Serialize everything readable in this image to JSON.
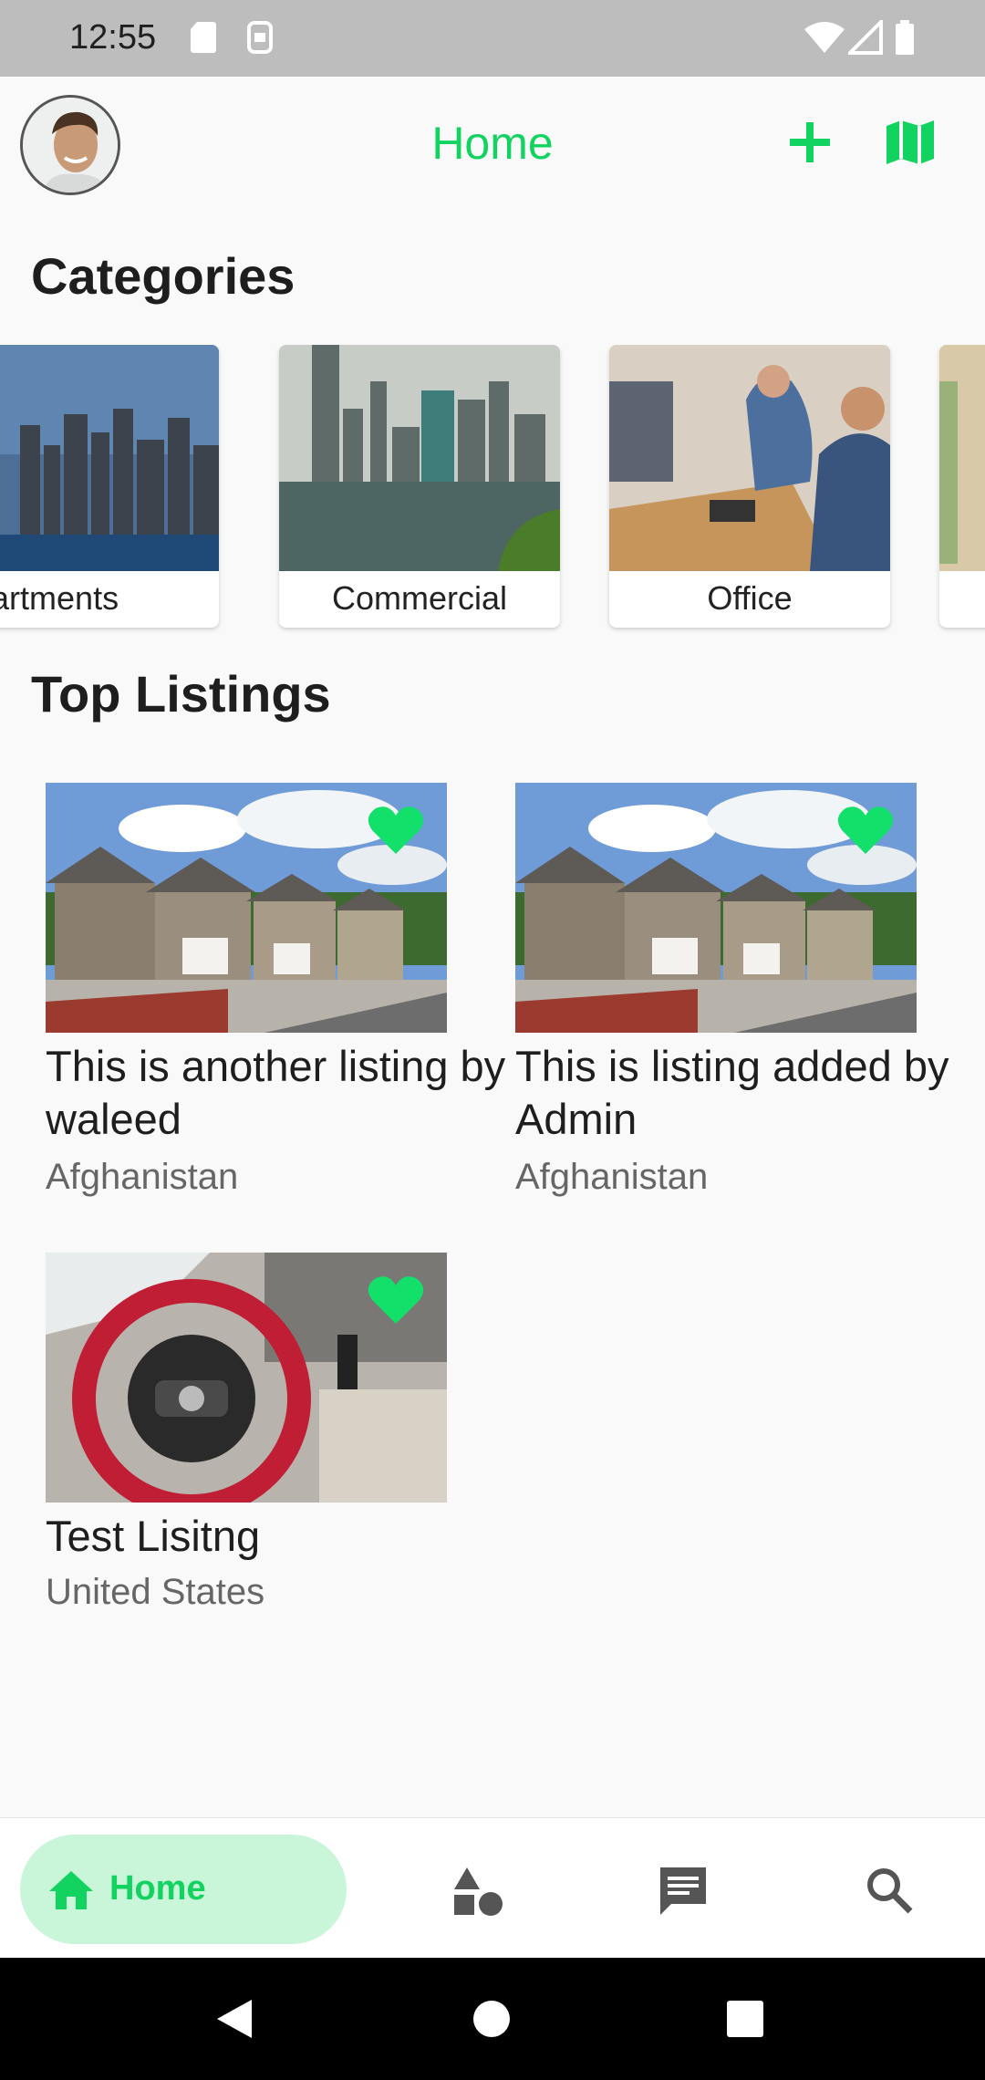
{
  "status_bar": {
    "time": "12:55"
  },
  "app_bar": {
    "title": "Home"
  },
  "categories_title": "Categories",
  "categories": [
    {
      "label": "Apartments"
    },
    {
      "label": "Commercial"
    },
    {
      "label": "Office"
    }
  ],
  "top_listings_title": "Top Listings",
  "listings": [
    {
      "title": "This is another listing by waleed",
      "location": "Afghanistan",
      "favorited": true
    },
    {
      "title": "This is listing added by Admin",
      "location": "Afghanistan",
      "favorited": true
    },
    {
      "title": "Test Lisitng",
      "location": "United States",
      "favorited": true
    }
  ],
  "bottom_nav": {
    "home_label": "Home"
  },
  "colors": {
    "accent": "#12d35f",
    "accent_light": "#c9f5d9"
  }
}
